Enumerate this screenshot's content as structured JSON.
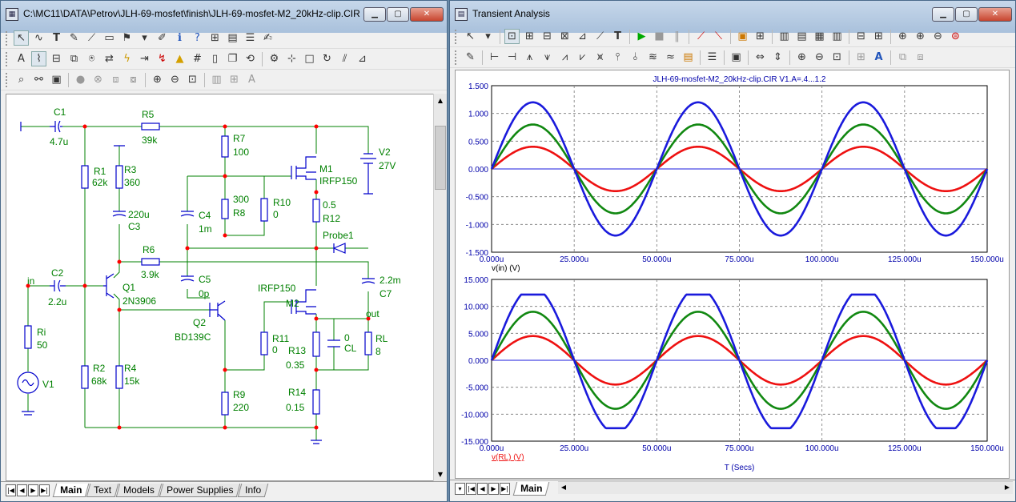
{
  "left_window": {
    "title": "C:\\MC11\\DATA\\Petrov\\JLH-69-mosfet\\finish\\JLH-69-mosfet-M2_20kHz-clip.CIR",
    "tabs": [
      "Main",
      "Text",
      "Models",
      "Power Supplies",
      "Info"
    ],
    "active_tab": "Main"
  },
  "right_window": {
    "title": "Transient Analysis",
    "tabs": [
      "Main"
    ],
    "active_tab": "Main"
  },
  "schematic": {
    "components": [
      {
        "ref": "C1",
        "value": "4.7u"
      },
      {
        "ref": "R5",
        "value": "39k"
      },
      {
        "ref": "R7",
        "value": "100"
      },
      {
        "ref": "V2",
        "value": "27V"
      },
      {
        "ref": "M1",
        "value": "IRFP150"
      },
      {
        "ref": "R1",
        "value": "62k"
      },
      {
        "ref": "R3",
        "value": "360"
      },
      {
        "ref": "C3",
        "value": "220u"
      },
      {
        "ref": "C4",
        "value": "1m"
      },
      {
        "ref": "R8",
        "value": "300"
      },
      {
        "ref": "R10",
        "value": "0"
      },
      {
        "ref": "R12",
        "value": "0.5"
      },
      {
        "ref": "R6",
        "value": "3.9k"
      },
      {
        "ref": "C2",
        "value": "2.2u"
      },
      {
        "ref": "Q1",
        "value": "2N3906"
      },
      {
        "ref": "C5",
        "value": "0p"
      },
      {
        "ref": "Q2",
        "value": "BD139C"
      },
      {
        "ref": "M2",
        "value": "IRFP150"
      },
      {
        "ref": "C7",
        "value": "2.2m"
      },
      {
        "ref": "Ri",
        "value": "50"
      },
      {
        "ref": "V1",
        "value": ""
      },
      {
        "ref": "R11",
        "value": "0"
      },
      {
        "ref": "R13",
        "value": "0.35"
      },
      {
        "ref": "CL",
        "value": "0"
      },
      {
        "ref": "RL",
        "value": "8"
      },
      {
        "ref": "R2",
        "value": "68k"
      },
      {
        "ref": "R4",
        "value": "15k"
      },
      {
        "ref": "R9",
        "value": "220"
      },
      {
        "ref": "R14",
        "value": "0.15"
      }
    ],
    "nodes": {
      "in": "in",
      "out": "out",
      "probe": "Probe1"
    }
  },
  "colors": {
    "wire": "#008000",
    "node": "#ff0000",
    "component": "#0000cc",
    "red_trace": "#ee1111",
    "green_trace": "#118811",
    "blue_trace": "#1a1adc",
    "axis_text": "#0000aa"
  },
  "chart_data": [
    {
      "type": "line",
      "title": "JLH-69-mosfet-M2_20kHz-clip.CIR V1.A=.4...1.2",
      "xlabel": "v(in) (V)",
      "ylabel": "",
      "xlim": [
        0,
        150
      ],
      "ylim": [
        -1.5,
        1.5
      ],
      "x_ticks": [
        "0.000u",
        "25.000u",
        "50.000u",
        "75.000u",
        "100.000u",
        "125.000u",
        "150.000u"
      ],
      "y_ticks": [
        "1.500",
        "1.000",
        "0.500",
        "0.000",
        "-0.500",
        "-1.000",
        "-1.500"
      ],
      "grid": true,
      "series": [
        {
          "color": "#ee1111",
          "amplitude": 0.4,
          "period_us": 50,
          "clip": null
        },
        {
          "color": "#118811",
          "amplitude": 0.8,
          "period_us": 50,
          "clip": null
        },
        {
          "color": "#1a1adc",
          "amplitude": 1.2,
          "period_us": 50,
          "clip": null
        }
      ]
    },
    {
      "type": "line",
      "title": "",
      "xlabel": "v(RL) (V)",
      "ylabel": "",
      "x_axis_title": "T (Secs)",
      "xlim": [
        0,
        150
      ],
      "ylim": [
        -15,
        15
      ],
      "x_ticks": [
        "0.000u",
        "25.000u",
        "50.000u",
        "75.000u",
        "100.000u",
        "125.000u",
        "150.000u"
      ],
      "y_ticks": [
        "15.000",
        "10.000",
        "5.000",
        "0.000",
        "-5.000",
        "-10.000",
        "-15.000"
      ],
      "grid": true,
      "series": [
        {
          "color": "#ee1111",
          "amplitude": 4.5,
          "period_us": 50,
          "clip": null
        },
        {
          "color": "#118811",
          "amplitude": 9.0,
          "period_us": 50,
          "clip": null
        },
        {
          "color": "#1a1adc",
          "amplitude": 13.5,
          "period_us": 50,
          "clip": [
            -12.6,
            12.2
          ]
        }
      ]
    }
  ]
}
